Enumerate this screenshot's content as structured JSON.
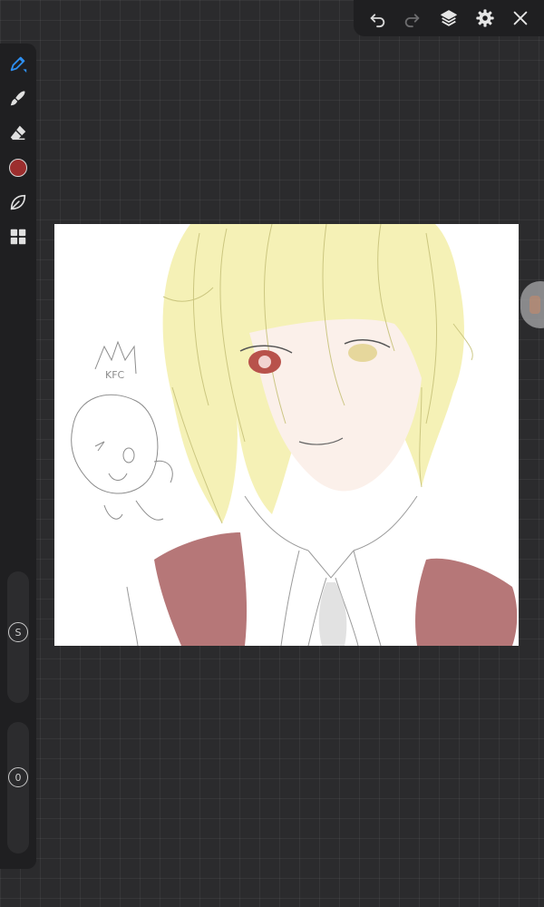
{
  "toolbar": {
    "undo_icon": "undo-icon",
    "redo_icon": "redo-icon",
    "layers_icon": "layers-icon",
    "settings_icon": "gear-icon",
    "close_icon": "close-icon"
  },
  "sidebar": {
    "tools": [
      "pen-icon",
      "brush-icon",
      "eraser-icon",
      "color-swatch",
      "leaf-icon",
      "grid-icon"
    ],
    "active_tool": "pen",
    "current_color": "#9c2e2e",
    "accent_color": "#2e8ff0",
    "size_slider_label": "S",
    "opacity_slider_label": "0"
  },
  "canvas": {
    "background": "#ffffff",
    "doodle_text": "KFC"
  }
}
